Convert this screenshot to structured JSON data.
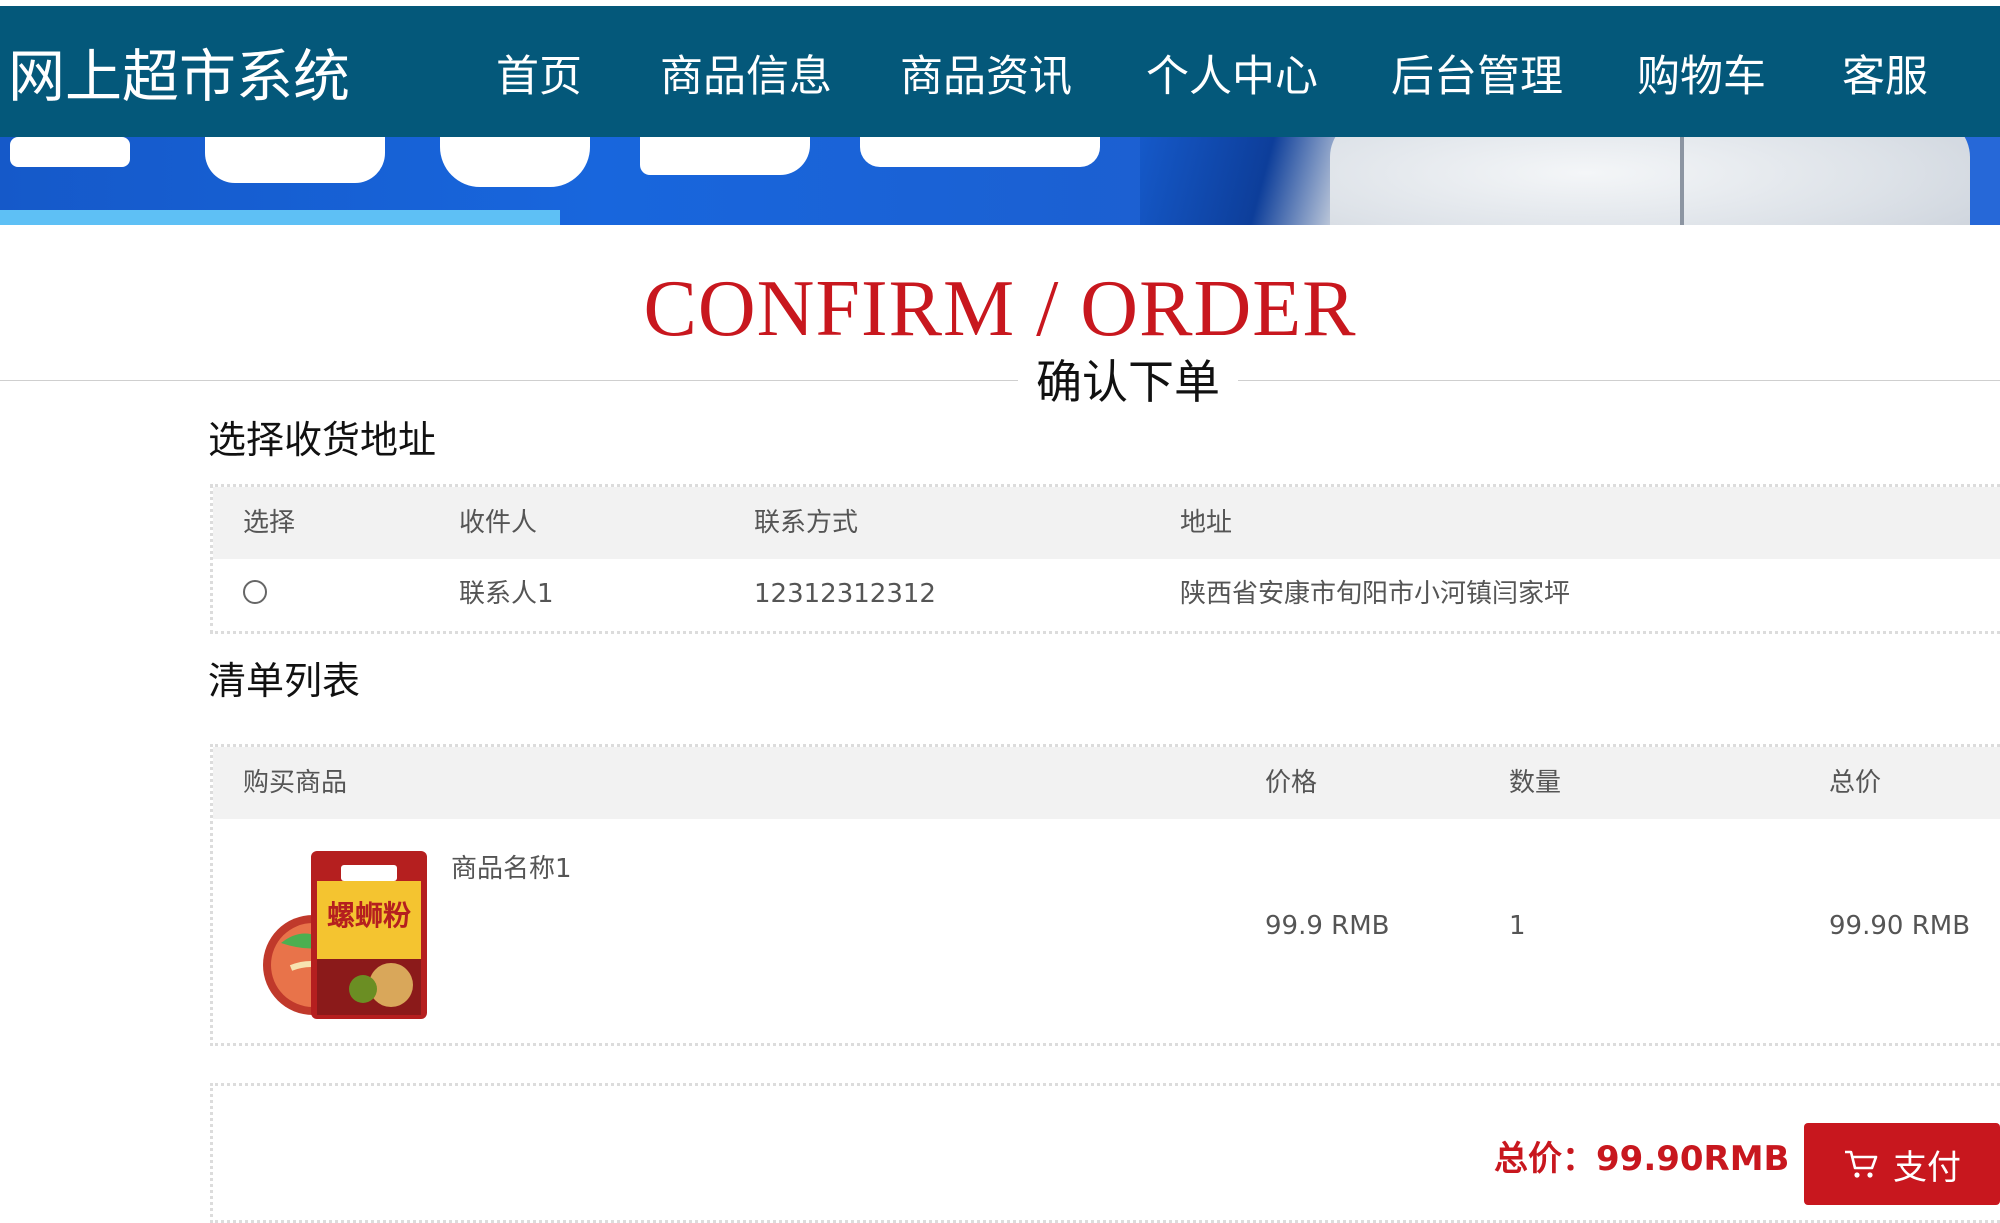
{
  "header": {
    "brand": "网上超市系统",
    "nav": [
      "首页",
      "商品信息",
      "商品资讯",
      "个人中心",
      "后台管理",
      "购物车",
      "客服"
    ],
    "active_nav": "商品信息"
  },
  "page": {
    "title_en": "CONFIRM / ORDER",
    "title_cn": "确认下单"
  },
  "address_section": {
    "title": "选择收货地址",
    "columns": [
      "选择",
      "收件人",
      "联系方式",
      "地址"
    ],
    "rows": [
      {
        "recipient": "联系人1",
        "phone": "12312312312",
        "address": "陕西省安康市旬阳市小河镇闫家坪"
      }
    ]
  },
  "list_section": {
    "title": "清单列表",
    "columns": [
      "购买商品",
      "价格",
      "数量",
      "总价"
    ],
    "rows": [
      {
        "name": "商品名称1",
        "price": "99.9 RMB",
        "quantity": "1",
        "total": "99.90 RMB",
        "image_text": "螺蛳粉"
      }
    ]
  },
  "footer": {
    "total_label": "总价：99.90RMB",
    "pay_label": "支付",
    "pay_icon": "cart-icon"
  },
  "colors": {
    "header_bg": "#04587a",
    "accent_red": "#c8171e"
  }
}
